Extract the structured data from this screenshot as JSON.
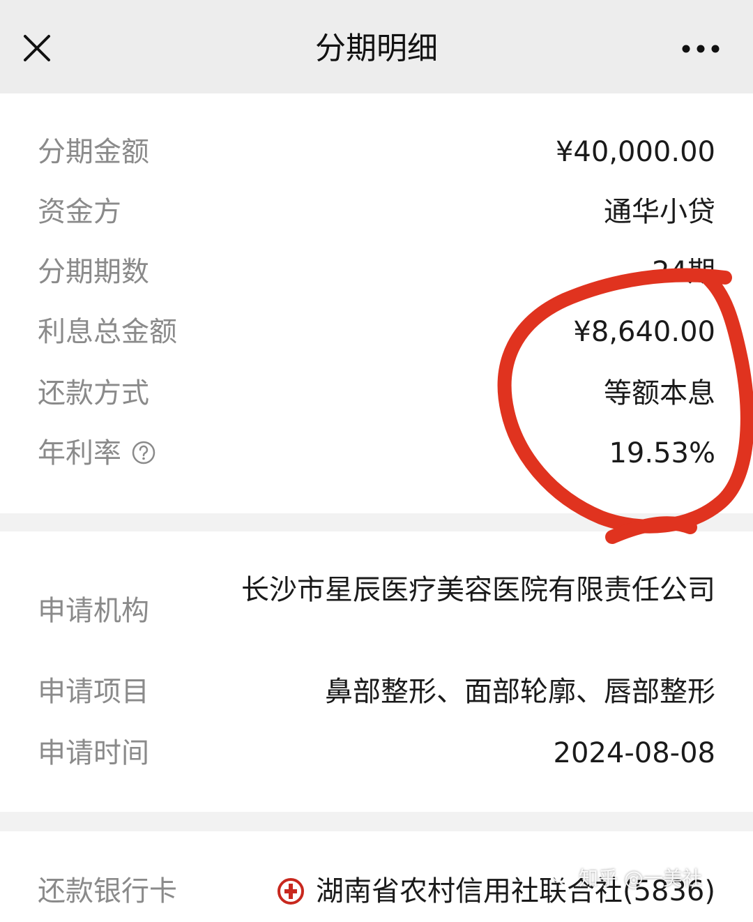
{
  "navbar": {
    "title": "分期明细"
  },
  "summary": {
    "amount_label": "分期金额",
    "amount_value": "¥40,000.00",
    "funder_label": "资金方",
    "funder_value": "通华小贷",
    "periods_label": "分期期数",
    "periods_value": "24期",
    "interest_label": "利息总金额",
    "interest_value": "¥8,640.00",
    "method_label": "还款方式",
    "method_value": "等额本息",
    "rate_label": "年利率",
    "rate_value": "19.53%"
  },
  "application": {
    "org_label": "申请机构",
    "org_value": "长沙市星辰医疗美容医院有限责任公司",
    "project_label": "申请项目",
    "project_value": "鼻部整形、面部轮廓、唇部整形",
    "time_label": "申请时间",
    "time_value": "2024-08-08"
  },
  "bank": {
    "label": "还款银行卡",
    "value": "湖南省农村信用社联合社(5836)"
  },
  "watermark": {
    "text": "知乎 @一美社"
  },
  "colors": {
    "annotation_red": "#e0331f",
    "label_gray": "#8a8a8a",
    "navbar_bg": "#ededed",
    "bank_logo_red": "#c8281e"
  }
}
